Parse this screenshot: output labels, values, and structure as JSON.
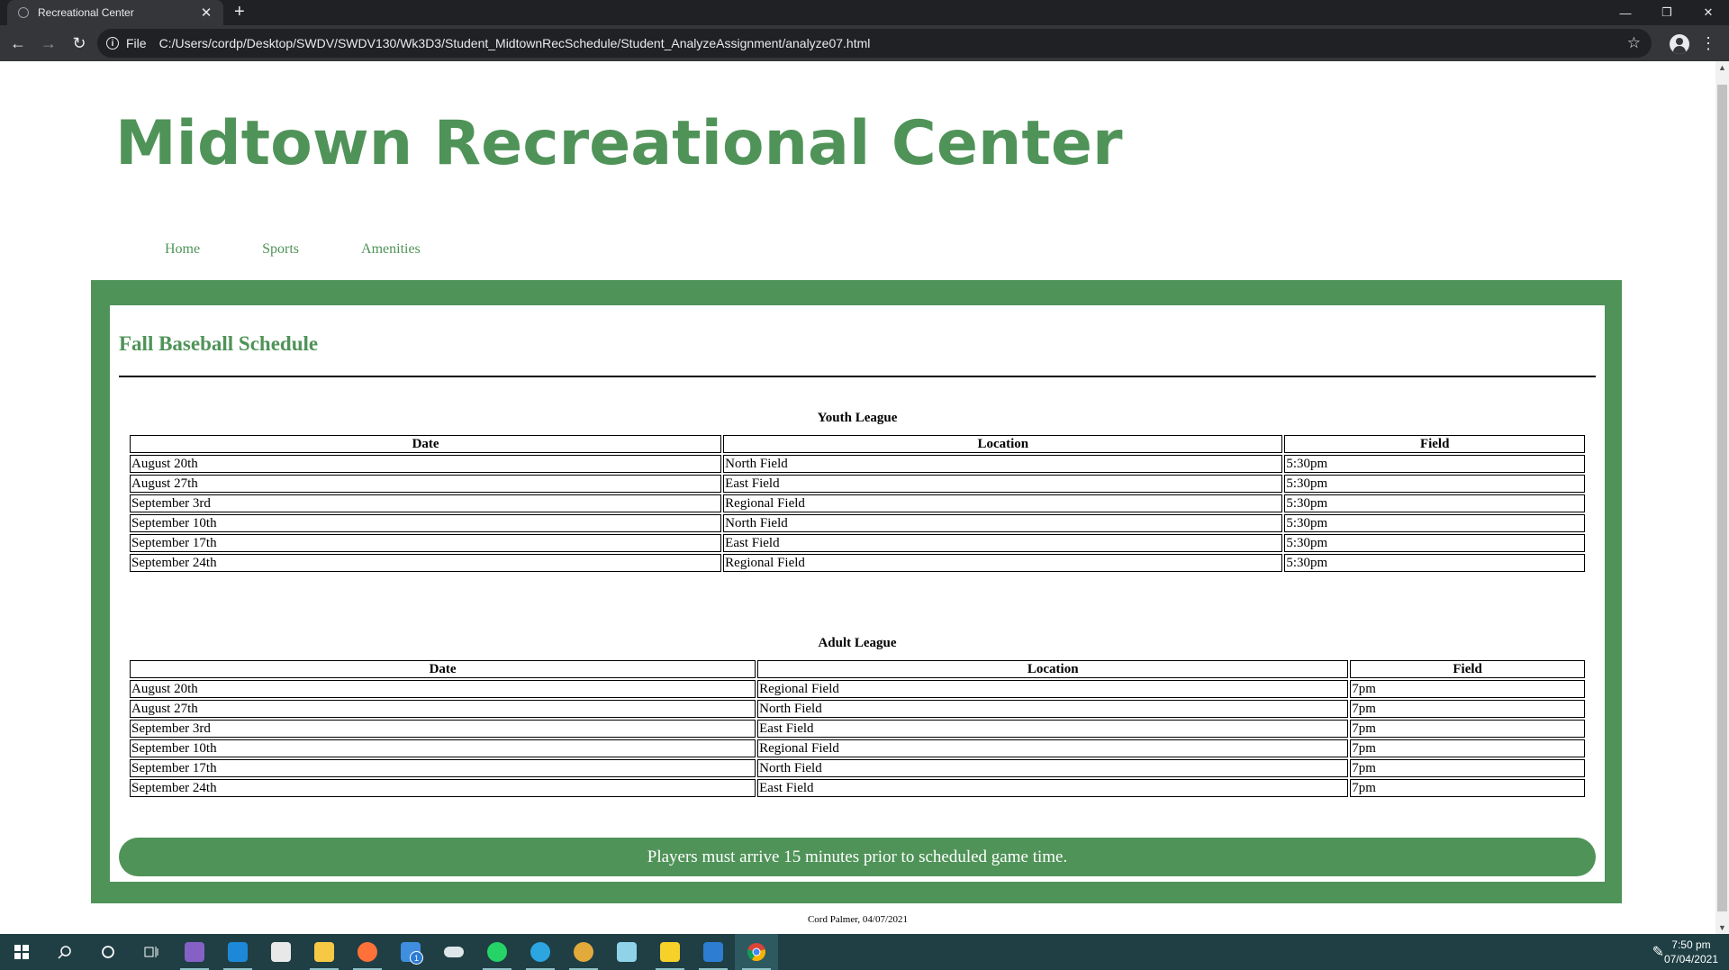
{
  "browser": {
    "tab_title": "Recreational Center",
    "tab_close": "✕",
    "new_tab": "+",
    "scheme": "File",
    "url": "C:/Users/cordp/Desktop/SWDV/SWDV130/Wk3D3/Student_MidtownRecSchedule/Student_AnalyzeAssignment/analyze07.html",
    "icons": [
      "back-icon",
      "forward-icon",
      "reload-icon",
      "info-icon",
      "star-icon",
      "profile-icon",
      "menu-icon"
    ]
  },
  "site": {
    "title": "Midtown Recreational Center",
    "nav": [
      "Home",
      "Sports",
      "Amenities"
    ],
    "brand_color": "#4f9358"
  },
  "schedule": {
    "title": "Fall Baseball Schedule",
    "youth": {
      "caption": "Youth League",
      "headers": [
        "Date",
        "Location",
        "Field"
      ],
      "rows": [
        [
          "August 20th",
          "North Field",
          "5:30pm"
        ],
        [
          "August 27th",
          "East Field",
          "5:30pm"
        ],
        [
          "September 3rd",
          "Regional Field",
          "5:30pm"
        ],
        [
          "September 10th",
          "North Field",
          "5:30pm"
        ],
        [
          "September 17th",
          "East Field",
          "5:30pm"
        ],
        [
          "September 24th",
          "Regional Field",
          "5:30pm"
        ]
      ]
    },
    "adult": {
      "caption": "Adult League",
      "headers": [
        "Date",
        "Location",
        "Field"
      ],
      "rows": [
        [
          "August 20th",
          "Regional Field",
          "7pm"
        ],
        [
          "August 27th",
          "North Field",
          "7pm"
        ],
        [
          "September 3rd",
          "East Field",
          "7pm"
        ],
        [
          "September 10th",
          "Regional Field",
          "7pm"
        ],
        [
          "September 17th",
          "North Field",
          "7pm"
        ],
        [
          "September 24th",
          "East Field",
          "7pm"
        ]
      ]
    },
    "notice": "Players must arrive 15 minutes prior to scheduled game time."
  },
  "footer": {
    "credit": "Cord Palmer, 04/07/2021"
  },
  "taskbar": {
    "time": "7:50 pm",
    "date": "07/04/2021",
    "mail_badge": "1",
    "apps": [
      "start-icon",
      "search-icon",
      "cortana-icon",
      "task-view-icon",
      "visual-studio-icon",
      "vscode-icon",
      "store-icon",
      "file-explorer-icon",
      "firefox-icon",
      "mail-icon",
      "onedrive-icon",
      "whatsapp-icon",
      "telegram-icon",
      "chrome-canary-icon",
      "notepad-icon",
      "sticky-notes-icon",
      "photos-icon",
      "chrome-icon"
    ]
  }
}
